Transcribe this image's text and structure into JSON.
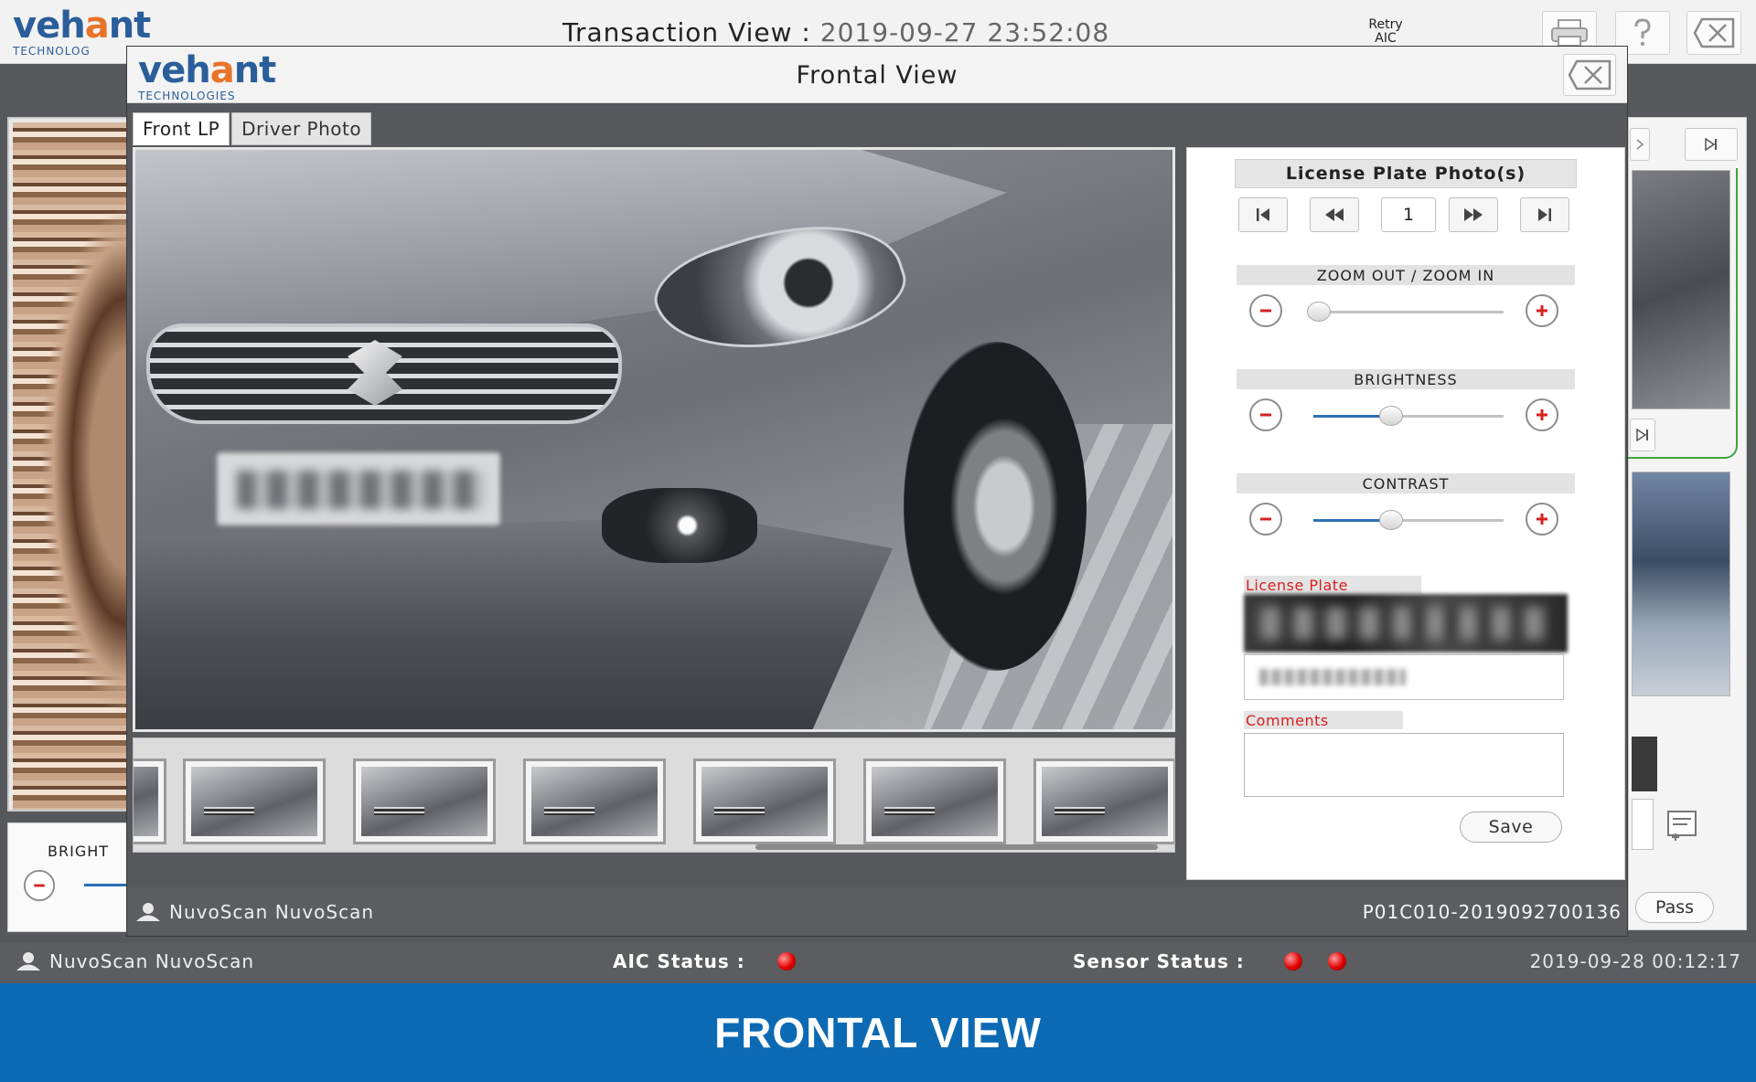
{
  "app": {
    "logo_word_prefix": "veh",
    "logo_word_o": "a",
    "logo_word_suffix": "nt",
    "logo_sub": "TECHNOLOG",
    "title_label": "Transaction View",
    "title_sep": " : ",
    "title_timestamp": "2019-09-27 23:52:08",
    "retry_line1": "Retry",
    "retry_line2": "AIC",
    "icons": [
      "printer-icon",
      "help-icon",
      "close-icon"
    ]
  },
  "background": {
    "brightness_label": "BRIGHT",
    "pass_label": "Pass"
  },
  "status_bar": {
    "user": "NuvoScan NuvoScan",
    "aic_label": "AIC Status :",
    "sensor_label": "Sensor Status :",
    "clock": "2019-09-28 00:12:17",
    "status_color": "#e00000"
  },
  "banner": {
    "text": "FRONTAL VIEW",
    "color": "#0c6ab4"
  },
  "modal": {
    "logo_word_prefix": "veh",
    "logo_word_o": "a",
    "logo_word_suffix": "nt",
    "logo_sub": "TECHNOLOGIES",
    "title": "Frontal View",
    "tabs": [
      {
        "label": "Front LP",
        "active": true
      },
      {
        "label": "Driver Photo",
        "active": false
      }
    ],
    "side": {
      "lp_header": "License Plate Photo(s)",
      "page": "1",
      "zoom_label": "ZOOM OUT / ZOOM IN",
      "brightness_label": "BRIGHTNESS",
      "contrast_label": "CONTRAST",
      "zoom_level": 0.03,
      "brightness_level": 0.41,
      "contrast_level": 0.41,
      "license_plate_label": "License Plate",
      "comments_label": "Comments",
      "save_label": "Save"
    },
    "footer": {
      "user": "NuvoScan NuvoScan",
      "transaction_id": "P01C010-2019092700136"
    }
  }
}
